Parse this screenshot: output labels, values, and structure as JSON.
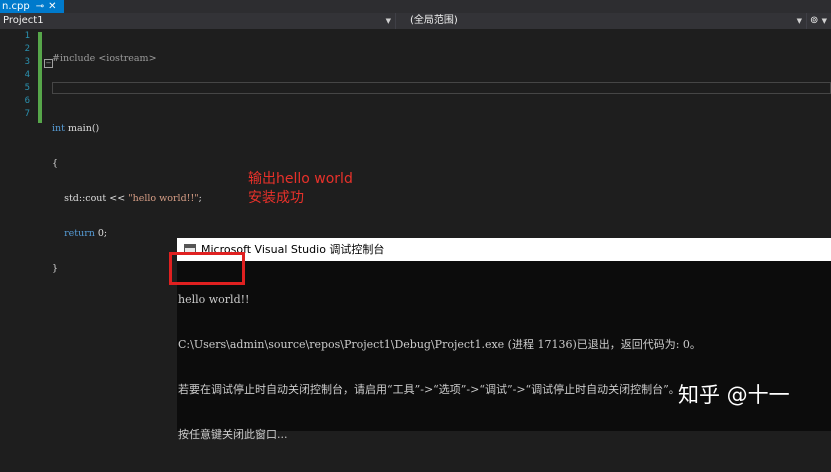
{
  "tab": {
    "label": "n.cpp",
    "pin": "⊸",
    "close": "✕"
  },
  "navbar": {
    "project": "Project1",
    "scope": "(全局范围)",
    "members_icon": "⊚"
  },
  "line_numbers": [
    "1",
    "2",
    "3",
    "4",
    "5",
    "6",
    "7"
  ],
  "code": {
    "line1_pp": "#include <iostream>",
    "line3_kw": "int",
    "line3_rest": " main()",
    "line4": "{",
    "line5_a": "std::cout << ",
    "line5_str": "\"hello world!!\"",
    "line5_b": ";",
    "line6_kw": "return",
    "line6_rest": " 0;",
    "line7": "}"
  },
  "annotation": {
    "line1": "输出hello world",
    "line2": "安装成功"
  },
  "console": {
    "title": "Microsoft Visual Studio 调试控制台",
    "lines": [
      "hello world!!",
      "C:\\Users\\admin\\source\\repos\\Project1\\Debug\\Project1.exe (进程 17136)已退出，返回代码为: 0。",
      "若要在调试停止时自动关闭控制台，请启用“工具”->“选项”->“调试”->“调试停止时自动关闭控制台”。",
      "按任意键关闭此窗口..."
    ]
  },
  "watermark": "知乎 @十一",
  "colors": {
    "accent": "#007acc",
    "annotation": "#e8312a",
    "keyword": "#569cd6",
    "string": "#d69d85"
  }
}
